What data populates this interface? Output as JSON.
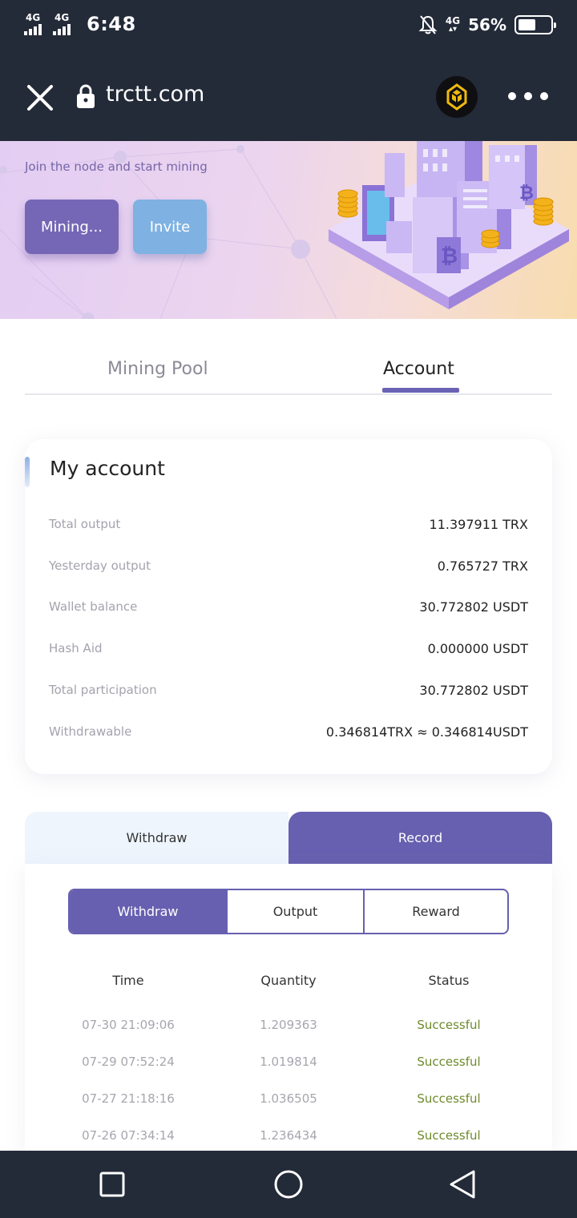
{
  "status_bar": {
    "signal1_label": "4G",
    "signal2_label": "4G",
    "time": "6:48",
    "network": "4G",
    "battery_percent": "56%",
    "battery_level": 0.56
  },
  "browser": {
    "url": "trctt.com",
    "icons": [
      "close-icon",
      "lock-icon",
      "bnb-icon",
      "more-icon"
    ]
  },
  "banner": {
    "subtitle": "Join the node and start mining",
    "mining_button": "Mining...",
    "invite_button": "Invite"
  },
  "tabs": {
    "mining_pool": "Mining Pool",
    "account": "Account",
    "active": "Account"
  },
  "account": {
    "title": "My account",
    "rows": [
      {
        "label": "Total output",
        "value": "11.397911 TRX"
      },
      {
        "label": "Yesterday output",
        "value": "0.765727 TRX"
      },
      {
        "label": "Wallet balance",
        "value": "30.772802 USDT"
      },
      {
        "label": "Hash Aid",
        "value": "0.000000 USDT"
      },
      {
        "label": "Total participation",
        "value": "30.772802 USDT"
      },
      {
        "label": "Withdrawable",
        "value": "0.346814TRX ≈ 0.346814USDT"
      }
    ]
  },
  "records": {
    "tab_withdraw": "Withdraw",
    "tab_record": "Record",
    "active_tab": "Record",
    "segments": [
      "Withdraw",
      "Output",
      "Reward"
    ],
    "active_segment": "Withdraw",
    "columns": [
      "Time",
      "Quantity",
      "Status"
    ],
    "rows": [
      {
        "time": "07-30 21:09:06",
        "quantity": "1.209363",
        "status": "Successful"
      },
      {
        "time": "07-29 07:52:24",
        "quantity": "1.019814",
        "status": "Successful"
      },
      {
        "time": "07-27 21:18:16",
        "quantity": "1.036505",
        "status": "Successful"
      },
      {
        "time": "07-26 07:34:14",
        "quantity": "1.236434",
        "status": "Successful"
      }
    ]
  },
  "colors": {
    "dark_bar": "#232a38",
    "accent_purple": "#6760b0",
    "invite_blue": "#7fb2e2",
    "success_green": "#6e8a2c"
  }
}
